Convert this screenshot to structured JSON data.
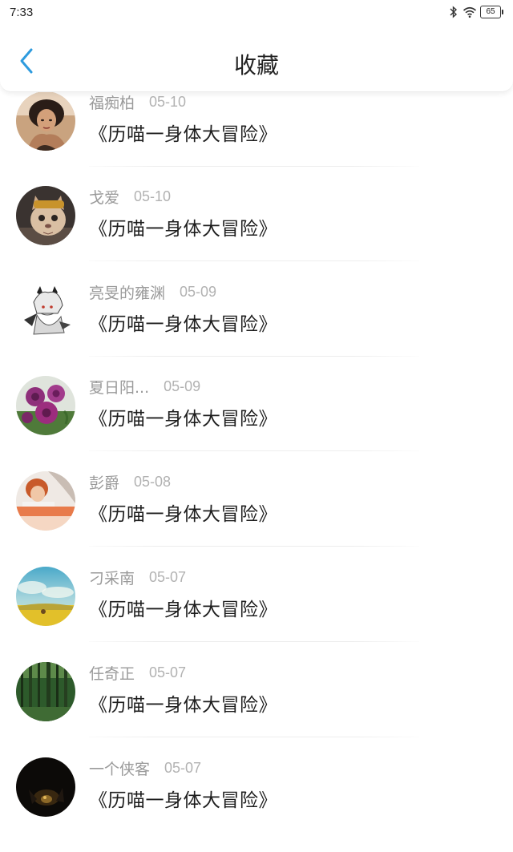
{
  "status_bar": {
    "time": "7:33",
    "battery": "65"
  },
  "header": {
    "title": "收藏"
  },
  "items": [
    {
      "name": "福痴柏",
      "date": "05-10",
      "title": "《历喵一身体大冒险》",
      "avatar": "woman-portrait"
    },
    {
      "name": "戈爱",
      "date": "05-10",
      "title": "《历喵一身体大冒险》",
      "avatar": "cat-photo"
    },
    {
      "name": "亮旻的雍渊",
      "date": "05-09",
      "title": "《历喵一身体大冒险》",
      "avatar": "anime-sketch"
    },
    {
      "name": "夏日阳...",
      "date": "05-09",
      "title": "《历喵一身体大冒险》",
      "avatar": "purple-flowers"
    },
    {
      "name": "彭爵",
      "date": "05-08",
      "title": "《历喵一身体大冒险》",
      "avatar": "person-orange-banner"
    },
    {
      "name": "刁采南",
      "date": "05-07",
      "title": "《历喵一身体大冒险》",
      "avatar": "sky-field-landscape"
    },
    {
      "name": "任奇正",
      "date": "05-07",
      "title": "《历喵一身体大冒险》",
      "avatar": "forest-trees"
    },
    {
      "name": "一个侠客",
      "date": "05-07",
      "title": "《历喵一身体大冒险》",
      "avatar": "dark-night-scene"
    }
  ],
  "colors": {
    "accent": "#2e9bde",
    "name_gray": "#9a9a9a",
    "date_gray": "#b2b2b2"
  }
}
